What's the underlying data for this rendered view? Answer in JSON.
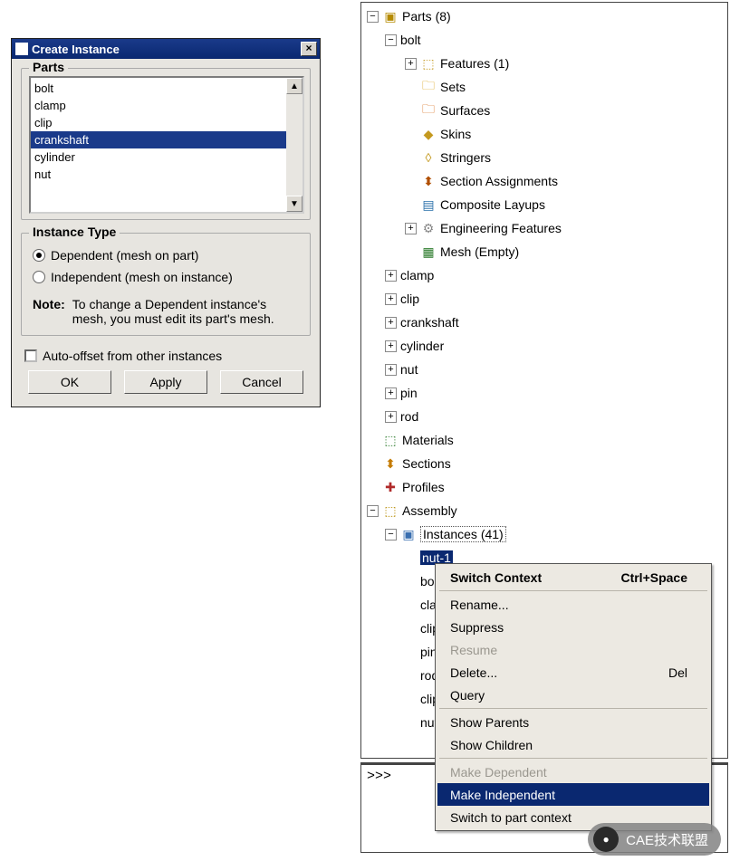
{
  "dialog": {
    "title": "Create Instance",
    "parts_legend": "Parts",
    "parts_items": [
      "bolt",
      "clamp",
      "clip",
      "crankshaft",
      "cylinder",
      "nut"
    ],
    "parts_selected": "crankshaft",
    "instance_type_legend": "Instance Type",
    "radio_dependent": "Dependent (mesh on part)",
    "radio_independent": "Independent (mesh on instance)",
    "radio_selected": "dependent",
    "note_label": "Note:",
    "note_body": "To change a Dependent instance's mesh, you must edit its part's mesh.",
    "auto_offset": "Auto-offset from other instances",
    "buttons": {
      "ok": "OK",
      "apply": "Apply",
      "cancel": "Cancel"
    }
  },
  "tree": {
    "root": {
      "toggle": "−",
      "label": "Parts (8)",
      "icon": "ic-parts"
    },
    "bolt": {
      "toggle": "−",
      "label": "bolt"
    },
    "bolt_children": [
      {
        "toggle": "+",
        "icon": "ic-feat",
        "label": "Features (1)"
      },
      {
        "icon": "ic-folder",
        "label": "Sets"
      },
      {
        "icon": "ic-surface",
        "label": "Surfaces"
      },
      {
        "icon": "ic-skin",
        "label": "Skins"
      },
      {
        "icon": "ic-stringer",
        "label": "Stringers"
      },
      {
        "icon": "ic-section",
        "label": "Section Assignments"
      },
      {
        "icon": "ic-comp",
        "label": "Composite Layups"
      },
      {
        "toggle": "+",
        "icon": "ic-eng",
        "label": "Engineering Features"
      },
      {
        "icon": "ic-mesh",
        "label": "Mesh (Empty)"
      }
    ],
    "other_parts": [
      {
        "label": "clamp"
      },
      {
        "label": "clip"
      },
      {
        "label": "crankshaft"
      },
      {
        "label": "cylinder"
      },
      {
        "label": "nut"
      },
      {
        "label": "pin"
      },
      {
        "label": "rod"
      }
    ],
    "siblings": [
      {
        "icon": "ic-mat",
        "label": "Materials"
      },
      {
        "icon": "ic-sect2",
        "label": "Sections"
      },
      {
        "icon": "ic-prof",
        "label": "Profiles"
      }
    ],
    "assembly": {
      "toggle": "−",
      "icon": "ic-asm",
      "label": "Assembly"
    },
    "instances": {
      "toggle": "−",
      "icon": "ic-inst",
      "label": "Instances (41)"
    },
    "instance_items": [
      "nut-1",
      "bolt",
      "clar",
      "clip-",
      "pin-",
      "rod-",
      "clip-",
      "nut-"
    ]
  },
  "ctx": {
    "items": [
      {
        "label": "Switch Context",
        "accel": "Ctrl+Space",
        "bold": true
      },
      {
        "label": "Rename..."
      },
      {
        "label": "Suppress"
      },
      {
        "label": "Resume",
        "disabled": true
      },
      {
        "label": "Delete...",
        "accel": "Del"
      },
      {
        "label": "Query"
      },
      {
        "label": "Show Parents"
      },
      {
        "label": "Show Children"
      },
      {
        "label": "Make Dependent",
        "disabled": true
      },
      {
        "label": "Make Independent",
        "highlight": true
      },
      {
        "label": "Switch to part context"
      }
    ]
  },
  "console": {
    "prompt": ">>>"
  },
  "watermark": {
    "icon": "●",
    "text": "CAE技术联盟"
  }
}
